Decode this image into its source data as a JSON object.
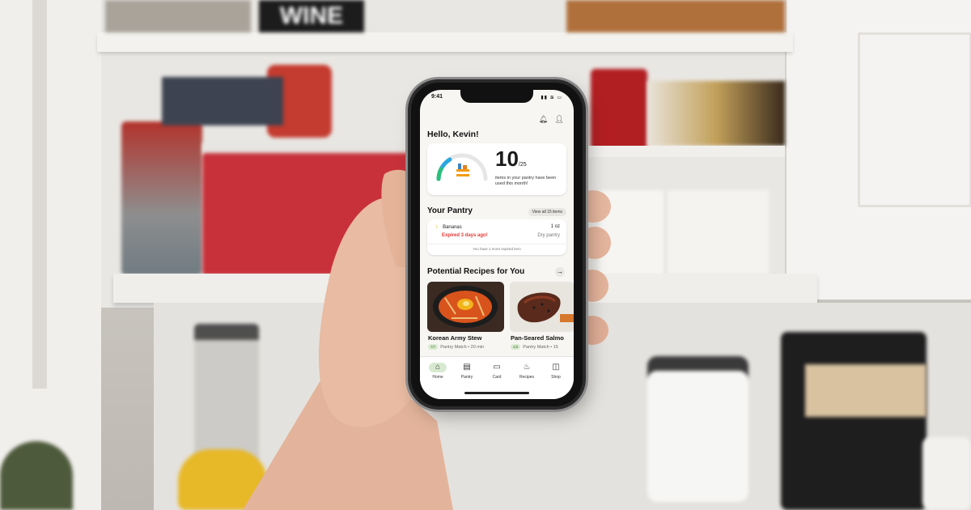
{
  "scene": {
    "background_sign": "WINE"
  },
  "status_bar": {
    "time": "9:41",
    "icons": "▮▮ ≋ ▭"
  },
  "header": {
    "greeting": "Hello, Kevin!",
    "bell_icon": "bell-icon",
    "profile_icon": "user-icon"
  },
  "pantry_gauge": {
    "value": "10",
    "denominator": "/25",
    "description": "items in your pantry have been used this month!",
    "colors": {
      "start": "#29a7e0",
      "end": "#2bbf7a",
      "track": "#e6e6e6"
    }
  },
  "your_pantry": {
    "title": "Your Pantry",
    "view_all": "View all 15 items",
    "item": {
      "name": "Bananas",
      "quantity": "1 oz",
      "status": "Expired 3 days ago!",
      "location": "Dry pantry"
    },
    "footer": "You have 1 more expired item"
  },
  "recipes": {
    "title": "Potential Recipes for You",
    "items": [
      {
        "title": "Korean Army Stew",
        "match": "7/7",
        "meta": "Pantry Match • 20 min"
      },
      {
        "title": "Pan-Seared Salmo",
        "match": "4/6",
        "meta": "Pantry Match • 15"
      }
    ]
  },
  "tabs": [
    {
      "label": "Home",
      "icon": "home-icon",
      "active": true
    },
    {
      "label": "Pantry",
      "icon": "pantry-icon"
    },
    {
      "label": "Card",
      "icon": "card-icon"
    },
    {
      "label": "Recipes",
      "icon": "recipes-icon"
    },
    {
      "label": "Shop",
      "icon": "shop-icon"
    }
  ]
}
